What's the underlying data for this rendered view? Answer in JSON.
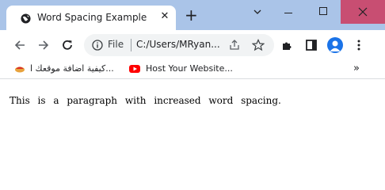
{
  "tab": {
    "title": "Word Spacing Example",
    "favicon": "globe-icon"
  },
  "omnibox": {
    "scheme_label": "File",
    "url": "C:/Users/MRyan..."
  },
  "bookmarks": [
    {
      "label": "كيفية اضافة موقعك ا...",
      "icon": "bookmark-site-icon"
    },
    {
      "label": "Host Your Website...",
      "icon": "youtube-icon"
    }
  ],
  "overflow_label": "»",
  "page": {
    "paragraph": "This is a paragraph with increased word spacing."
  },
  "colors": {
    "tabstrip": "#aac4e8",
    "close_hover": "#c84e72",
    "avatar": "#1a73e8"
  }
}
